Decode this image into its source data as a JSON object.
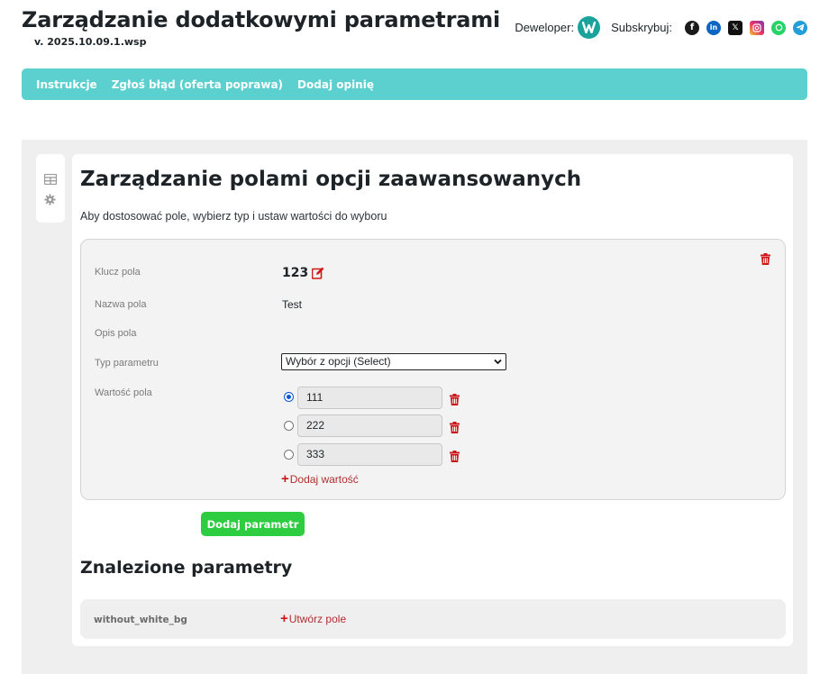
{
  "header": {
    "title": "Zarządzanie dodatkowymi parametrami",
    "version": "v. 2025.10.09.1.wsp",
    "developer_label": "Deweloper:",
    "subscribe_label": "Subskrybuj:",
    "social_icons": [
      "facebook-icon",
      "linkedin-icon",
      "x-icon",
      "instagram-icon",
      "whatsapp-icon",
      "telegram-icon"
    ]
  },
  "nav": {
    "items": [
      {
        "label": "Instrukcje"
      },
      {
        "label": "Zgłoś błąd (oferta poprawa)"
      },
      {
        "label": "Dodaj opinię"
      }
    ]
  },
  "sidebar_tabs": [
    "table-icon",
    "gear-icon"
  ],
  "main": {
    "heading": "Zarządzanie polami opcji zaawansowanych",
    "description": "Aby dostosować pole, wybierz typ i ustaw wartości do wyboru"
  },
  "param": {
    "key_label": "Klucz pola",
    "key_value": "123",
    "name_label": "Nazwa pola",
    "name_value": "Test",
    "desc_label": "Opis pola",
    "desc_value": "",
    "type_label": "Typ parametru",
    "type_value": "Wybór z opcji (Select)",
    "values_label": "Wartość pola",
    "values": [
      {
        "value": "111",
        "selected": true
      },
      {
        "value": "222",
        "selected": false
      },
      {
        "value": "333",
        "selected": false
      }
    ],
    "add_value_label": "Dodaj wartość"
  },
  "add_param_label": "Dodaj parametr",
  "found": {
    "heading": "Znalezione parametry",
    "items": [
      {
        "key": "without_white_bg",
        "action": "Utwórz pole"
      }
    ]
  },
  "colors": {
    "accent_nav": "#5bd0cf",
    "danger": "#cc1818",
    "button_green": "#2ecc40"
  }
}
